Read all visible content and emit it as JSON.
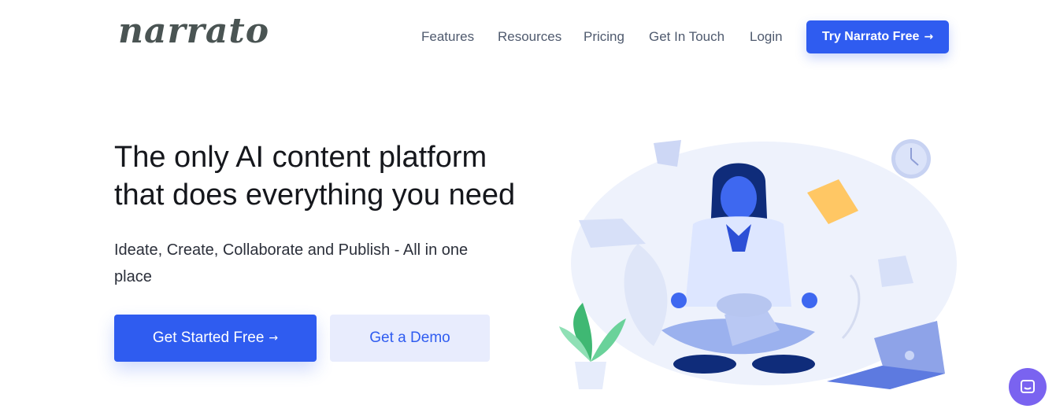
{
  "header": {
    "logo_text": "narrato",
    "nav": [
      {
        "label": "Features"
      },
      {
        "label": "Resources"
      },
      {
        "label": "Pricing"
      },
      {
        "label": "Get In Touch"
      },
      {
        "label": "Login"
      }
    ],
    "cta": {
      "label": "Try Narrato Free",
      "icon": "arrow-right-icon"
    }
  },
  "hero": {
    "headline_line1": "The only AI content platform",
    "headline_line2": "that does everything you need",
    "subheadline": "Ideate, Create, Collaborate and Publish - All in one place",
    "primary_button": {
      "label": "Get Started Free",
      "icon": "arrow-right-icon"
    },
    "secondary_button": {
      "label": "Get a Demo"
    }
  },
  "illustration": {
    "icons": [
      "meditating-person",
      "clock-icon",
      "laptop-icon",
      "plant-icon",
      "paper-sheet-icon",
      "sticky-note-icon"
    ]
  },
  "chat_widget": {
    "icon": "chat-icon"
  },
  "colors": {
    "accent": "#2f5cf0",
    "secondary_bg": "#e8ecfd",
    "chat": "#7a63f0",
    "text": "#15171c",
    "nav_text": "#4f5a6e",
    "logo": "#4a5453"
  }
}
